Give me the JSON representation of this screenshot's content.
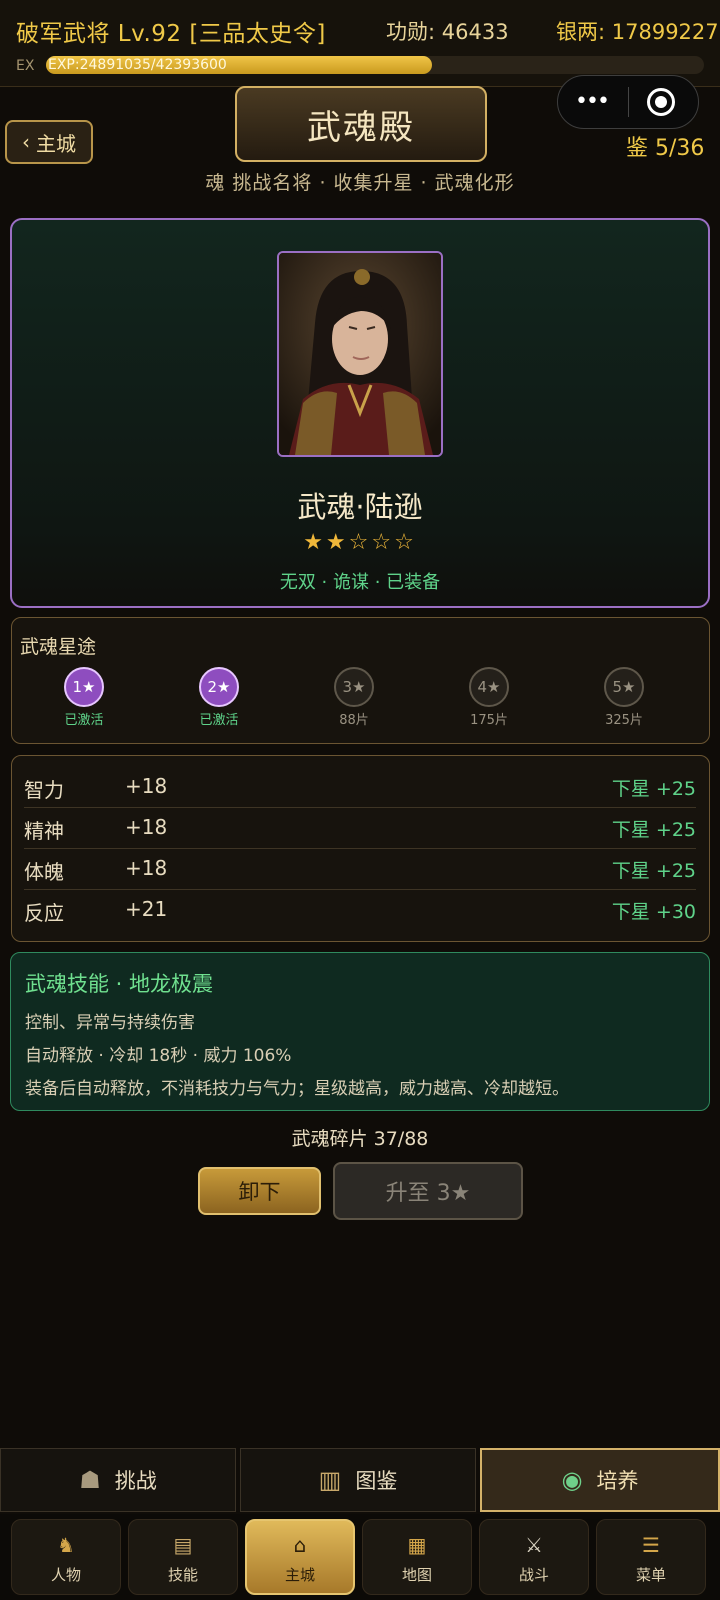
{
  "status": {
    "title": "破军武将 Lv.92 [三品太史令]",
    "merit": "功勋: 46433",
    "silver": "银两: 17899227",
    "ex_label": "EX",
    "exp_text": "EXP:24891035/42393600",
    "exp_progress": 0.587
  },
  "header": {
    "back_label": "主城",
    "title": "武魂殿",
    "codex_count": "鉴 5/36",
    "subtitle": "魂 挑战名将 · 收集升星 · 武魂化形"
  },
  "hero": {
    "name": "武魂·陆逊",
    "stars": "★★☆☆☆",
    "star_level": 2,
    "tags": "无双 · 诡谋 · 已装备"
  },
  "star_path": {
    "title": "武魂星途",
    "nodes": [
      {
        "label": "1★",
        "status": "已激活",
        "active": true
      },
      {
        "label": "2★",
        "status": "已激活",
        "active": true
      },
      {
        "label": "3★",
        "status": "88片",
        "active": false
      },
      {
        "label": "4★",
        "status": "175片",
        "active": false
      },
      {
        "label": "5★",
        "status": "325片",
        "active": false
      }
    ]
  },
  "attributes": [
    {
      "name": "智力",
      "value": "+18",
      "next": "下星 +25"
    },
    {
      "name": "精神",
      "value": "+18",
      "next": "下星 +25"
    },
    {
      "name": "体魄",
      "value": "+18",
      "next": "下星 +25"
    },
    {
      "name": "反应",
      "value": "+21",
      "next": "下星 +30"
    }
  ],
  "skill": {
    "title": "武魂技能 · 地龙极震",
    "type": "控制、异常与持续伤害",
    "stats": "自动释放 · 冷却 18秒 · 威力 106%",
    "desc": "装备后自动释放，不消耗技力与气力；星级越高，威力越高、冷却越短。"
  },
  "fragments": "武魂碎片 37/88",
  "actions": {
    "unequip": "卸下",
    "upgrade": "升至 3★"
  },
  "subtabs": [
    {
      "label": "挑战",
      "icon": "mask-icon",
      "active": false
    },
    {
      "label": "图鉴",
      "icon": "book-icon",
      "active": false
    },
    {
      "label": "培养",
      "icon": "orb-icon",
      "active": true
    }
  ],
  "nav": [
    {
      "label": "人物",
      "icon": "warrior-icon",
      "active": false
    },
    {
      "label": "技能",
      "icon": "scroll-icon",
      "active": false
    },
    {
      "label": "主城",
      "icon": "pagoda-icon",
      "active": true
    },
    {
      "label": "地图",
      "icon": "map-icon",
      "active": false
    },
    {
      "label": "战斗",
      "icon": "crossed-swords-icon",
      "active": false
    },
    {
      "label": "菜单",
      "icon": "menu-scroll-icon",
      "active": false
    }
  ]
}
